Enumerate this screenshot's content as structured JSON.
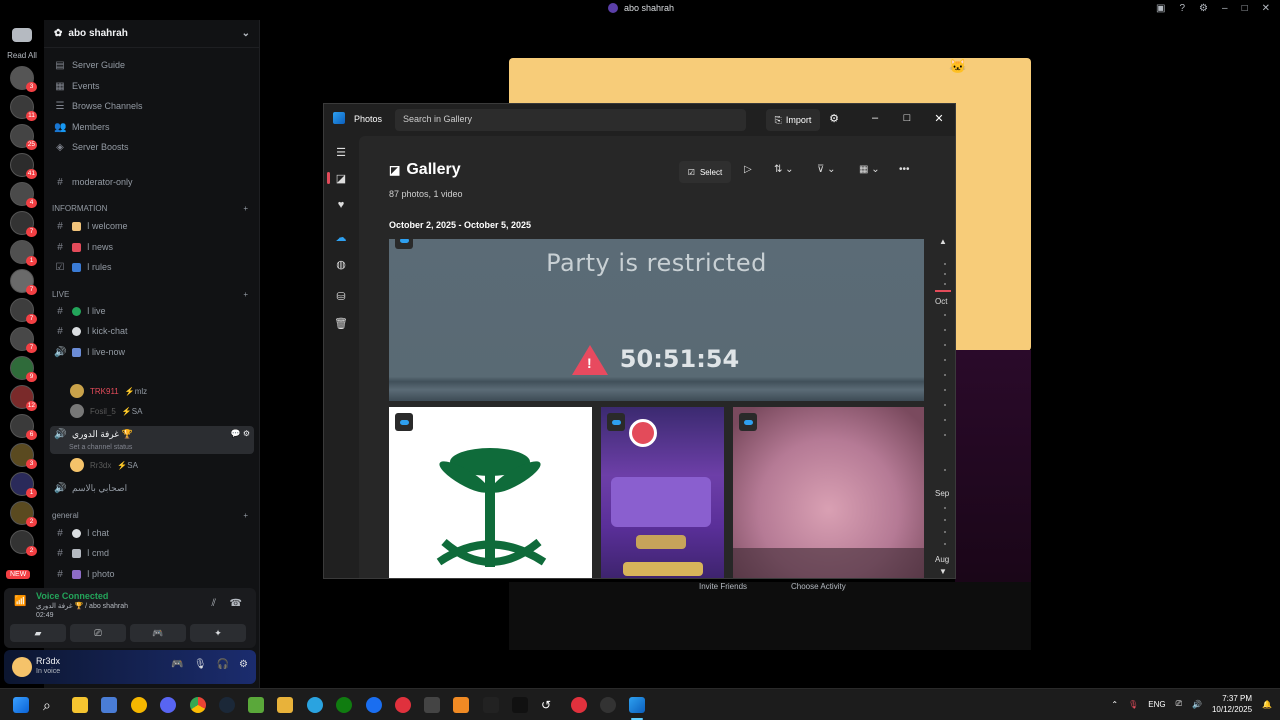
{
  "window": {
    "title": "abo shahrah"
  },
  "rail": {
    "read_all": "Read All",
    "new_label": "NEW",
    "badges": [
      "3",
      "11",
      "25",
      "41",
      "4",
      "7",
      "1",
      "7",
      "7",
      "7",
      "9",
      "12",
      "6",
      "3",
      "1",
      "2",
      "2"
    ]
  },
  "server": {
    "name": "abo shahrah",
    "menu": [
      {
        "label": "Server Guide",
        "icon": "guide-icon"
      },
      {
        "label": "Events",
        "icon": "calendar-icon"
      },
      {
        "label": "Browse Channels",
        "icon": "list-icon"
      },
      {
        "label": "Members",
        "icon": "members-icon"
      },
      {
        "label": "Server Boosts",
        "icon": "boost-icon"
      }
    ],
    "moderator": "moderator-only",
    "cat_information": "INFORMATION",
    "info_channels": [
      "ا welcome",
      "ا news",
      "ا rules"
    ],
    "cat_live": "LIVE",
    "live_channels": [
      "ا live",
      "ا kick-chat",
      "ا live-now"
    ],
    "voice_users": [
      {
        "name": "TRK911",
        "tag": "⚡mlz"
      },
      {
        "name": "Fosil_5",
        "tag": "⚡SA"
      }
    ],
    "active_voice": {
      "name": "غرفة الدوري 🏆",
      "status": "Set a channel status"
    },
    "active_voice_user": {
      "name": "Rr3dx",
      "tag": "⚡SA"
    },
    "second_voice": "اصحابي بالاسم",
    "cat_general": "general",
    "general_channels": [
      "ا chat",
      "ا cmd",
      "ا photo"
    ]
  },
  "voice": {
    "status": "Voice Connected",
    "channel": "غرفة الدوري 🏆 / abo shahrah",
    "time": "02:49"
  },
  "user": {
    "name": "Rr3dx",
    "status": "In voice"
  },
  "activity": {
    "invite": "Invite Friends",
    "choose": "Choose Activity"
  },
  "photos": {
    "app_name": "Photos",
    "search_placeholder": "Search in Gallery",
    "import_label": "Import",
    "gallery_title": "Gallery",
    "count": "87 photos, 1 video",
    "date_range": "October 2, 2025 - October 5, 2025",
    "select_label": "Select",
    "photo_text": "Party is restricted",
    "photo_timer": "50:51:54",
    "timeline": [
      "Oct",
      "Sep",
      "Aug"
    ]
  },
  "taskbar": {
    "lang": "ENG",
    "time": "7:37 PM",
    "date": "10/12/2025"
  },
  "colors": {
    "discord_bg": "#111214",
    "accent_green": "#23a55a",
    "photos_bg": "#202020",
    "stream_yellow": "#f7cc79"
  }
}
